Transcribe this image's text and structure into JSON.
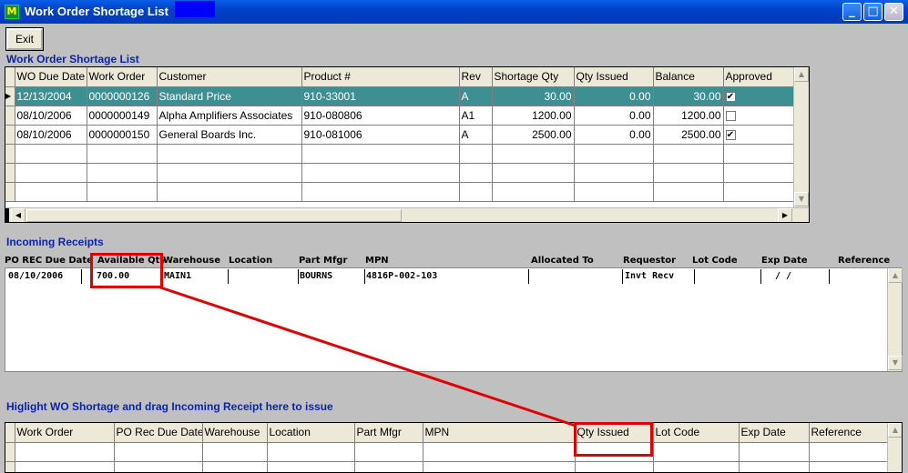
{
  "window": {
    "title": "Work Order Shortage List",
    "app_icon_glyph": "M",
    "buttons": {
      "minimize": "_",
      "maximize": "□",
      "close": "✕"
    }
  },
  "toolbar": {
    "exit_label": "Exit"
  },
  "shortage": {
    "section_title": "Work Order Shortage List",
    "columns": [
      "WO Due Date",
      "Work Order",
      "Customer",
      "Product #",
      "Rev",
      "Shortage Qty",
      "Qty Issued",
      "Balance",
      "Approved"
    ],
    "rows": [
      {
        "due": "12/13/2004",
        "wo": "0000000126",
        "customer": "Standard Price",
        "product": "910-33001",
        "rev": "A",
        "shortage": "30.00",
        "issued": "0.00",
        "balance": "30.00",
        "approved": true
      },
      {
        "due": "08/10/2006",
        "wo": "0000000149",
        "customer": "Alpha Amplifiers Associates",
        "product": "910-080806",
        "rev": "A1",
        "shortage": "1200.00",
        "issued": "0.00",
        "balance": "1200.00",
        "approved": false
      },
      {
        "due": "08/10/2006",
        "wo": "0000000150",
        "customer": "General Boards Inc.",
        "product": "910-081006",
        "rev": "A",
        "shortage": "2500.00",
        "issued": "0.00",
        "balance": "2500.00",
        "approved": true
      }
    ]
  },
  "receipts": {
    "section_title": "Incoming Receipts",
    "columns": [
      "PO REC Due Date",
      "Available Qty",
      "Warehouse",
      "Location",
      "Part Mfgr",
      "MPN",
      "Allocated To",
      "Requestor",
      "Lot Code",
      "Exp Date",
      "Reference"
    ],
    "row": {
      "due": "08/10/2006",
      "qty": "700.00",
      "warehouse": "MAIN1",
      "location": "",
      "mfgr": "BOURNS",
      "mpn": "4816P-002-103",
      "allocated": "",
      "requestor": "Invt Recv",
      "lot": "",
      "exp": "/  /",
      "reference": ""
    }
  },
  "issue": {
    "section_title": "Higlight WO Shortage and drag Incoming Receipt here to issue",
    "columns": [
      "Work Order",
      "PO Rec Due Date",
      "Warehouse",
      "Location",
      "Part Mfgr",
      "MPN",
      "Qty Issued",
      "Lot Code",
      "Exp Date",
      "Reference"
    ]
  },
  "colors": {
    "selection": "#3e8f91",
    "title": "#0b25a8",
    "annotation": "#e00000"
  }
}
